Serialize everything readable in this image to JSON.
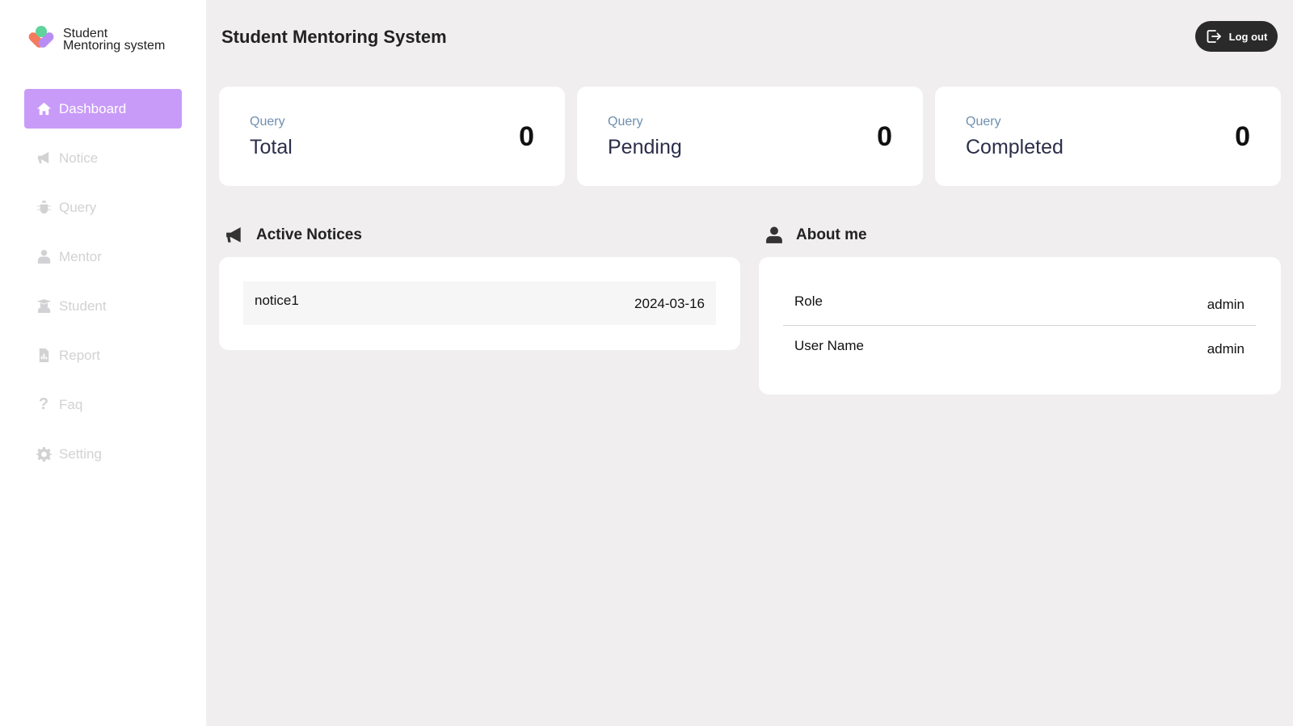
{
  "app": {
    "logo_line1": "Student",
    "logo_line2": "Mentoring system",
    "page_title": "Student Mentoring System",
    "logout_label": "Log out"
  },
  "sidebar": {
    "items": [
      {
        "label": "Dashboard",
        "icon": "home-icon"
      },
      {
        "label": "Notice",
        "icon": "megaphone-icon"
      },
      {
        "label": "Query",
        "icon": "bug-icon"
      },
      {
        "label": "Mentor",
        "icon": "user-tie-icon"
      },
      {
        "label": "Student",
        "icon": "graduate-icon"
      },
      {
        "label": "Report",
        "icon": "report-icon"
      },
      {
        "label": "Faq",
        "icon": "question-icon"
      },
      {
        "label": "Setting",
        "icon": "gear-icon"
      }
    ]
  },
  "stats": [
    {
      "small": "Query",
      "label": "Total",
      "value": "0"
    },
    {
      "small": "Query",
      "label": "Pending",
      "value": "0"
    },
    {
      "small": "Query",
      "label": "Completed",
      "value": "0"
    }
  ],
  "notices": {
    "heading": "Active Notices",
    "items": [
      {
        "title": "notice1",
        "date": "2024-03-16"
      }
    ]
  },
  "about": {
    "heading": "About me",
    "rows": [
      {
        "key": "Role",
        "value": "admin"
      },
      {
        "key": "User Name",
        "value": "admin"
      }
    ]
  },
  "colors": {
    "accent": "#c89bf8",
    "background": "#f0eeef",
    "button_dark": "#2a2a2a"
  }
}
